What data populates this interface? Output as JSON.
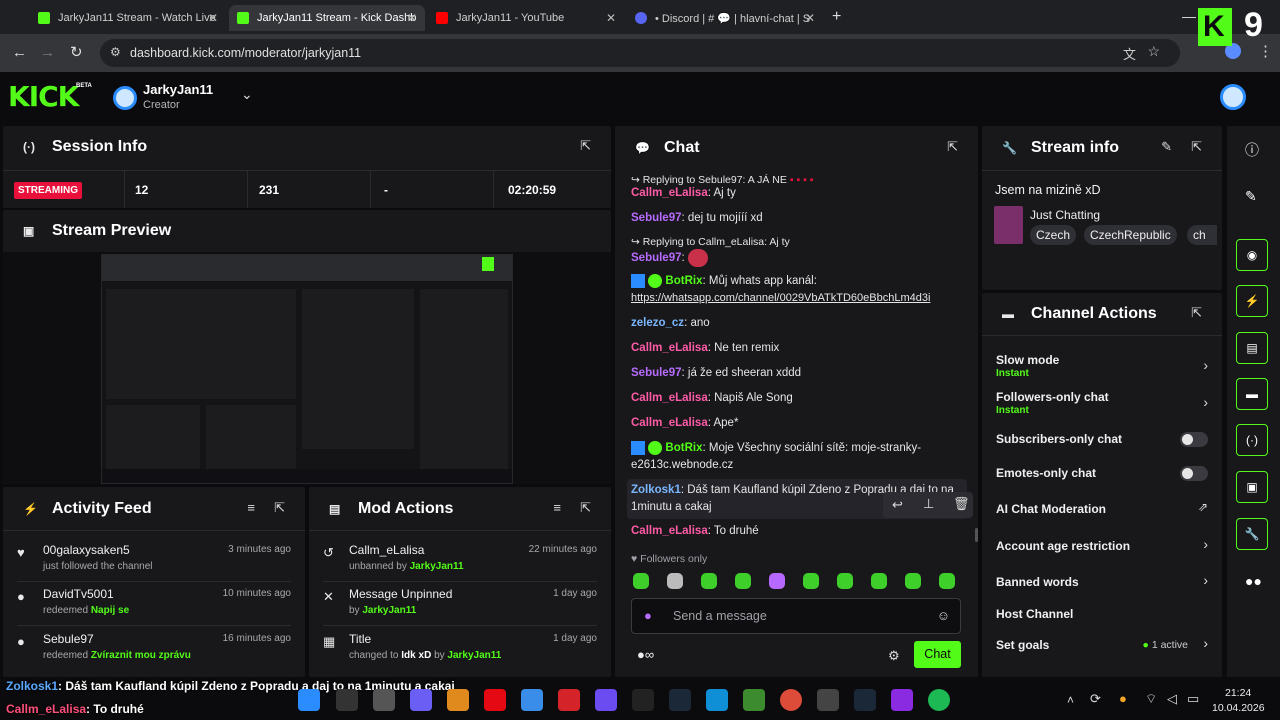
{
  "browser": {
    "tabs": [
      {
        "title": "JarkyJan11 Stream - Watch Live",
        "color": "#53fc18"
      },
      {
        "title": "JarkyJan11 Stream - Kick Dashb",
        "color": "#53fc18"
      },
      {
        "title": "JarkyJan11 - YouTube",
        "color": "#ff0000"
      },
      {
        "title": "• Discord | # 💬 | hlavní-chat | S",
        "color": "#5865f2"
      }
    ],
    "url": "dashboard.kick.com/moderator/jarkyjan11"
  },
  "overlay_badge": "9",
  "header": {
    "logo": "KICK",
    "logo_sup": "BETA",
    "channel_name": "JarkyJan11",
    "channel_role": "Creator"
  },
  "session": {
    "title": "Session Info",
    "status": "STREAMING",
    "stats": [
      "12",
      "231",
      "-",
      "02:20:59"
    ]
  },
  "preview": {
    "title": "Stream Preview"
  },
  "activity": {
    "title": "Activity Feed",
    "items": [
      {
        "name": "00galaxysaken5",
        "sub": "just followed the channel",
        "sub_hl": "",
        "time": "3 minutes ago"
      },
      {
        "name": "DavidTv5001",
        "sub": "redeemed",
        "sub_hl": "Napij se",
        "time": "10 minutes ago"
      },
      {
        "name": "Sebule97",
        "sub": "redeemed",
        "sub_hl": "Zvíraznit mou zprávu",
        "time": "16 minutes ago"
      }
    ]
  },
  "modactions": {
    "title": "Mod Actions",
    "items": [
      {
        "name": "Callm_eLalisa",
        "sub": "unbanned by",
        "who": "JarkyJan11",
        "time": "22 minutes ago"
      },
      {
        "name": "Message Unpinned",
        "sub": "by",
        "who": "JarkyJan11",
        "time": "1 day ago"
      },
      {
        "name": "Title",
        "sub": "changed to",
        "extra": "Idk xD",
        "sub2": "by",
        "who": "JarkyJan11",
        "time": "1 day ago"
      }
    ]
  },
  "chat": {
    "title": "Chat",
    "messages": [
      {
        "reply": "Replying to Sebule97: A JÁ NE",
        "user": "Callm_eLalisa",
        "color": "pink",
        "text": "Aj ty"
      },
      {
        "reply": "",
        "user": "Sebule97",
        "color": "violet",
        "text": "dej tu mojííí xd"
      },
      {
        "reply": "Replying to Callm_eLalisa: Aj ty",
        "user": "Sebule97",
        "color": "violet",
        "text": ""
      },
      {
        "reply": "",
        "user": "BotRix",
        "color": "green",
        "text": "Můj whats app kanál:",
        "link": "https://whatsapp.com/channel/0029VbATkTD60eBbchLm4d3i"
      },
      {
        "reply": "",
        "user": "zelezo_cz",
        "color": "blue",
        "text": "ano"
      },
      {
        "reply": "",
        "user": "Callm_eLalisa",
        "color": "pink",
        "text": "Ne ten remix"
      },
      {
        "reply": "",
        "user": "Sebule97",
        "color": "violet",
        "text": "já že ed sheeran xddd"
      },
      {
        "reply": "",
        "user": "Callm_eLalisa",
        "color": "pink",
        "text": "Napiš Ale Song"
      },
      {
        "reply": "",
        "user": "Callm_eLalisa",
        "color": "pink",
        "text": "Ape*"
      },
      {
        "reply": "",
        "user": "BotRix",
        "color": "green",
        "text": "Moje Všechny sociální sítě: moje-stranky-e2613c.webnode.cz"
      },
      {
        "reply": "",
        "user": "Zolkosk1",
        "color": "blue",
        "text": "Dáš tam Kaufland kúpil Zdeno z Popradu a daj to na 1minutu a cakaj"
      },
      {
        "reply": "",
        "user": "Callm_eLalisa",
        "color": "pink",
        "text": "To druhé"
      }
    ],
    "mode": "Followers only",
    "placeholder": "Send a message",
    "send_label": "Chat"
  },
  "streaminfo": {
    "title": "Stream info",
    "stream_title": "Jsem na mizině xD",
    "category": "Just Chatting",
    "tags": [
      "Czech",
      "CzechRepublic",
      "ch"
    ]
  },
  "channelactions": {
    "title": "Channel Actions",
    "items": [
      {
        "label": "Slow mode",
        "sub": "Instant",
        "ctrl": "chevron"
      },
      {
        "label": "Followers-only chat",
        "sub": "Instant",
        "ctrl": "chevron"
      },
      {
        "label": "Subscribers-only chat",
        "sub": "",
        "ctrl": "toggle"
      },
      {
        "label": "Emotes-only chat",
        "sub": "",
        "ctrl": "toggle"
      },
      {
        "label": "AI Chat Moderation",
        "sub": "",
        "ctrl": "external"
      },
      {
        "label": "Account age restriction",
        "sub": "",
        "ctrl": "chevron"
      },
      {
        "label": "Banned words",
        "sub": "",
        "ctrl": "chevron"
      },
      {
        "label": "Host Channel",
        "sub": "",
        "ctrl": ""
      },
      {
        "label": "Set goals",
        "sub": "",
        "ctrl": "chevron",
        "badge": "1 active"
      }
    ]
  },
  "overlay_chat": [
    {
      "user": "Zolkosk1",
      "text": ": Dáš tam Kaufland kúpil Zdeno z Popradu a daj to na 1minutu a cakaj"
    },
    {
      "user": "Callm_eLalisa",
      "text": ": To druhé"
    }
  ],
  "taskbar": {
    "time": "21:24",
    "date": "10.04.2026"
  }
}
